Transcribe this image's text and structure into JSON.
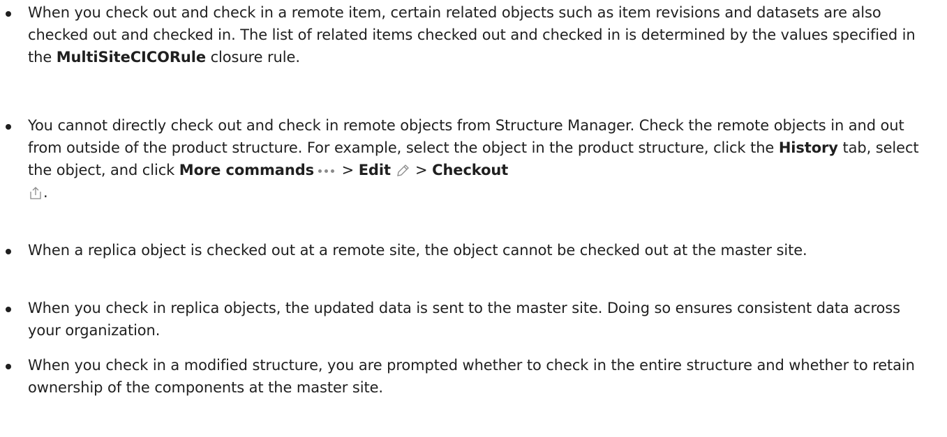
{
  "bullets": [
    {
      "part1": "When you check out and check in a remote item, certain related objects such as item revisions and datasets are also checked out and checked in. The list of related items checked out and checked in is determined by the values specified in the ",
      "bold1": "MultiSiteCICORule",
      "part2": " closure rule."
    },
    {
      "part1": "You cannot directly check out and check in remote objects from Structure Manager. Check the remote objects in and out from outside of the product structure. For example, select the object in the product structure, click the ",
      "bold1": "History",
      "part2": " tab, select the object, and click ",
      "bold2": "More commands",
      "sep1": " > ",
      "bold3": "Edit",
      "sep2": " > ",
      "bold4": "Checkout",
      "end": "."
    },
    {
      "text": "When a replica object is checked out at a remote site, the object cannot be checked out at the master site."
    },
    {
      "text": "When you check in replica objects, the updated data is sent to the master site. Doing so ensures consistent data across your organization."
    },
    {
      "text": "When you check in a modified structure, you are prompted whether to check in the entire structure and whether to retain ownership of the components at the master site."
    }
  ],
  "icons": [
    "more-commands-icon",
    "edit-pencil-icon",
    "checkout-icon"
  ]
}
